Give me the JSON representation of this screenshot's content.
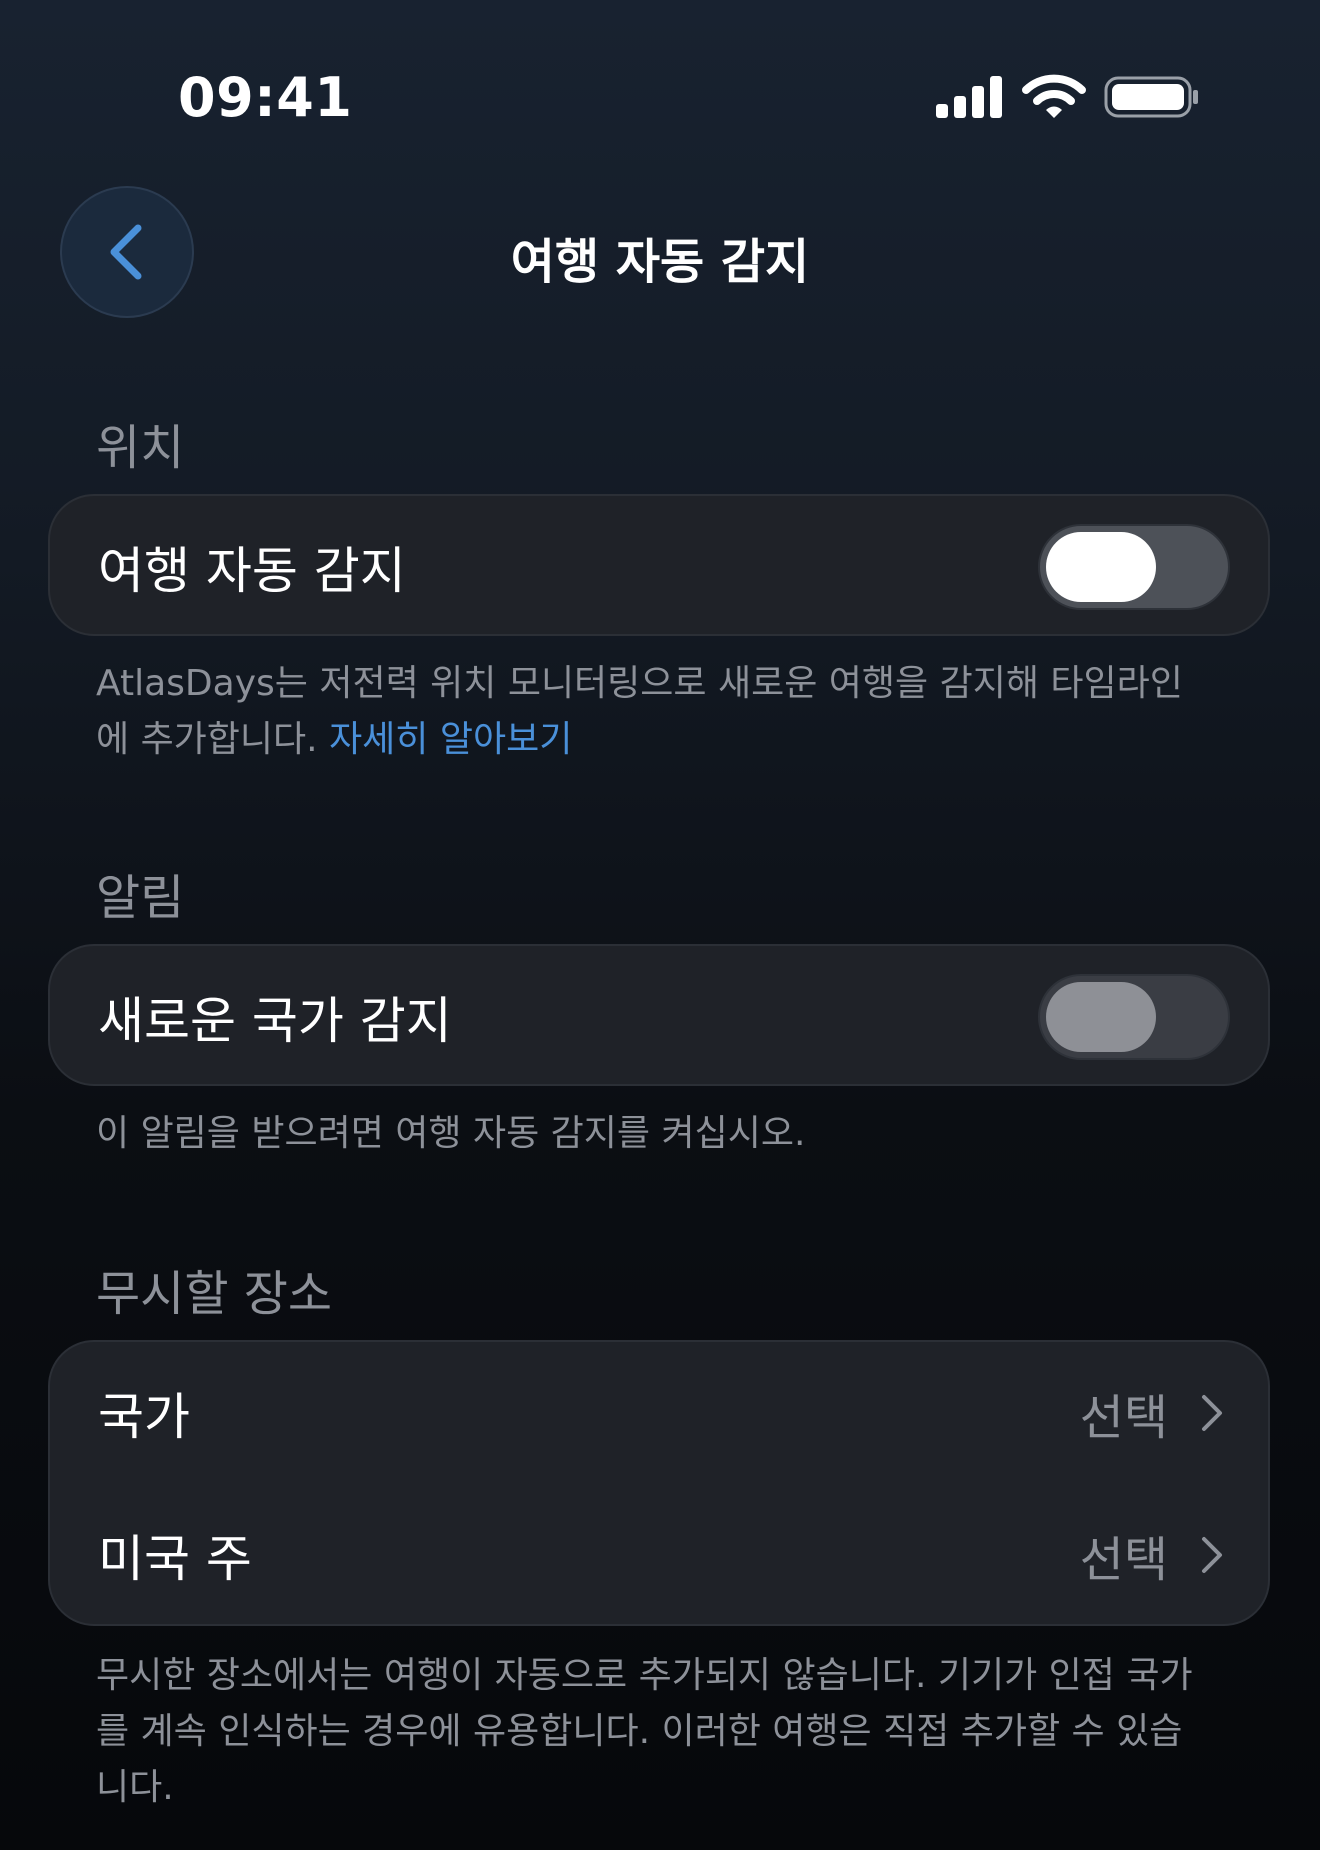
{
  "status_bar": {
    "time": "09:41",
    "icons": [
      "cellular-signal-icon",
      "wifi-icon",
      "battery-icon"
    ]
  },
  "nav": {
    "back_icon": "chevron-left-icon",
    "title": "여행 자동 감지"
  },
  "sections": {
    "location": {
      "header": "위치",
      "toggle_label": "여행 자동 감지",
      "toggle_on": true,
      "footnote_text": "AtlasDays는 저전력 위치 모니터링으로 새로운 여행을 감지해 타임라인에 추가합니다.",
      "footnote_link": "자세히 알아보기"
    },
    "alerts": {
      "header": "알림",
      "toggle_label": "새로운 국가 감지",
      "toggle_on": false,
      "toggle_enabled": false,
      "footnote": "이 알림을 받으려면 여행 자동 감지를 켜십시오."
    },
    "ignored_places": {
      "header": "무시할 장소",
      "rows": [
        {
          "label": "국가",
          "value": "선택"
        },
        {
          "label": "미국 주",
          "value": "선택"
        }
      ],
      "footnote": "무시한 장소에서는 여행이 자동으로 추가되지 않습니다. 기기가 인접 국가를 계속 인식하는 경우에 유용합니다. 이러한 여행은 직접 추가할 수 있습니다."
    }
  },
  "colors": {
    "accent": "#4a90d9",
    "card_background": "#1f2228",
    "secondary_text": "#8d9199"
  }
}
